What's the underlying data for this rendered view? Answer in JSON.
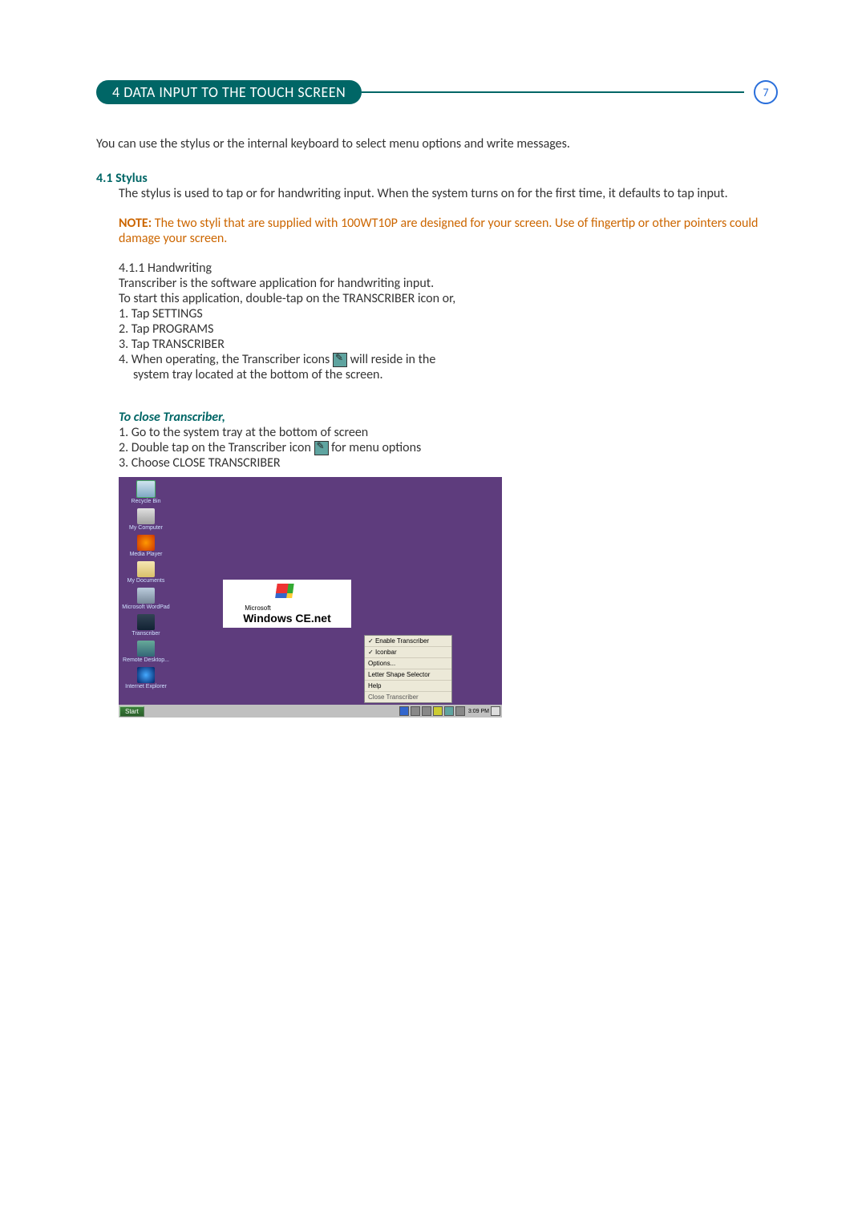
{
  "header": {
    "title": "4 DATA INPUT TO THE TOUCH SCREEN",
    "page_number": "7"
  },
  "intro": "You can use the stylus or the internal keyboard to select menu options and write messages.",
  "section41": {
    "label": "4.1 Stylus",
    "body": "The stylus is used to tap or for handwriting input. When the system turns on for the first time, it defaults to tap input."
  },
  "note": {
    "prefix": "NOTE:",
    "text": " The two styli that are supplied with 100WT10P are designed for your screen. Use of fingertip or other pointers could damage your screen."
  },
  "handwriting": {
    "title": "4.1.1 Handwriting",
    "line1": "Transcriber is the software application for handwriting input.",
    "line2": "To start this application, double-tap on the TRANSCRIBER icon or,",
    "step1": "1.  Tap SETTINGS",
    "step2": "2.  Tap PROGRAMS",
    "step3": "3.  Tap TRANSCRIBER",
    "step4a": "4.  When operating, the Transcriber icons ",
    "step4b": " will reside in the",
    "step4c": "system tray located at the bottom of the screen."
  },
  "close": {
    "title": "To close Transcriber,",
    "step1": "1. Go to the system tray at the bottom of screen",
    "step2a": "2. Double tap on the Transcriber icon ",
    "step2b": " for menu options",
    "step3": "3. Choose CLOSE TRANSCRIBER"
  },
  "screenshot": {
    "icons": {
      "recycle": "Recycle Bin",
      "mycomputer": "My Computer",
      "mediaplayer": "Media Player",
      "mydocs": "My Documents",
      "wordpad": "Microsoft WordPad",
      "transcriber": "Transcriber",
      "remote": "Remote Desktop...",
      "ie": "Internet Explorer"
    },
    "logo_small": "Microsoft",
    "logo_main": "Windows CE.net",
    "menu": {
      "enable": "Enable Transcriber",
      "iconbar": "Iconbar",
      "options": "Options...",
      "letter": "Letter Shape Selector",
      "help": "Help",
      "close": "Close Transcriber"
    },
    "start": "Start",
    "clock": "3:09 PM"
  }
}
